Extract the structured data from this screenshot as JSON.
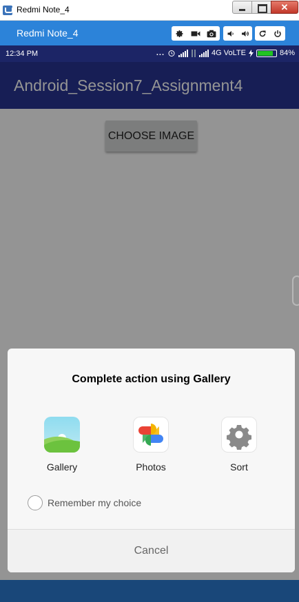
{
  "window": {
    "title": "Redmi Note_4"
  },
  "emulator": {
    "title": "Redmi Note_4"
  },
  "status_bar": {
    "time": "12:34 PM",
    "dots": "...",
    "network": "4G VoLTE",
    "battery_percent": "84%",
    "battery_level": 0.84
  },
  "app_bar": {
    "title": "Android_Session7_Assignment4"
  },
  "content": {
    "choose_button_label": "CHOOSE IMAGE"
  },
  "dialog": {
    "title": "Complete action using Gallery",
    "options": [
      {
        "label": "Gallery",
        "icon": "gallery-icon"
      },
      {
        "label": "Photos",
        "icon": "google-photos-icon"
      },
      {
        "label": "Sort",
        "icon": "gear-icon"
      }
    ],
    "remember_label": "Remember my choice",
    "cancel_label": "Cancel"
  },
  "colors": {
    "app_bar": "#283593",
    "status_bar": "#1c2566",
    "emulator_bar": "#2c83d9",
    "battery": "#22c322"
  }
}
